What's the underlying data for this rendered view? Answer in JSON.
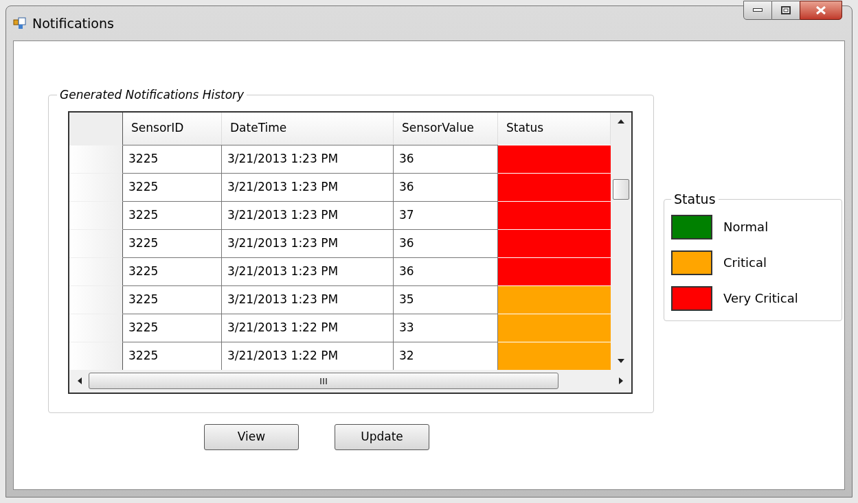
{
  "window": {
    "title": "Notifications"
  },
  "history": {
    "title": "Generated Notifications History",
    "columns": [
      "SensorID",
      "DateTime",
      "SensorValue",
      "Status"
    ],
    "rows": [
      {
        "sensor_id": "3225",
        "date_time": "3/21/2013 1:23 PM",
        "sensor_value": "36",
        "color": "#ff0000"
      },
      {
        "sensor_id": "3225",
        "date_time": "3/21/2013 1:23 PM",
        "sensor_value": "36",
        "color": "#ff0000"
      },
      {
        "sensor_id": "3225",
        "date_time": "3/21/2013 1:23 PM",
        "sensor_value": "37",
        "color": "#ff0000"
      },
      {
        "sensor_id": "3225",
        "date_time": "3/21/2013 1:23 PM",
        "sensor_value": "36",
        "color": "#ff0000"
      },
      {
        "sensor_id": "3225",
        "date_time": "3/21/2013 1:23 PM",
        "sensor_value": "36",
        "color": "#ff0000"
      },
      {
        "sensor_id": "3225",
        "date_time": "3/21/2013 1:23 PM",
        "sensor_value": "35",
        "color": "#ffa500"
      },
      {
        "sensor_id": "3225",
        "date_time": "3/21/2013 1:22 PM",
        "sensor_value": "33",
        "color": "#ffa500"
      },
      {
        "sensor_id": "3225",
        "date_time": "3/21/2013 1:22 PM",
        "sensor_value": "32",
        "color": "#ffa500"
      }
    ]
  },
  "legend": {
    "title": "Status",
    "items": [
      {
        "label": "Normal",
        "color": "#008000"
      },
      {
        "label": "Critical",
        "color": "#ffa500"
      },
      {
        "label": "Very Critical",
        "color": "#ff0000"
      }
    ]
  },
  "buttons": [
    "View",
    "Update"
  ]
}
